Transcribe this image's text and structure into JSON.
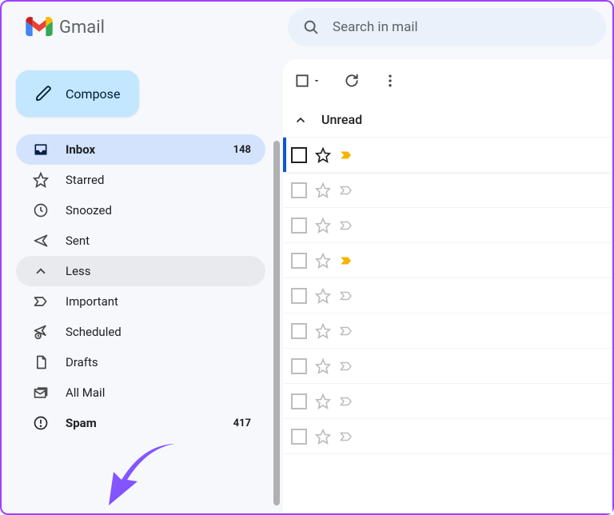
{
  "brand": {
    "name": "Gmail"
  },
  "search": {
    "placeholder": "Search in mail"
  },
  "compose": {
    "label": "Compose"
  },
  "sidebar": {
    "inbox": {
      "label": "Inbox",
      "count": "148"
    },
    "starred": {
      "label": "Starred"
    },
    "snoozed": {
      "label": "Snoozed"
    },
    "sent": {
      "label": "Sent"
    },
    "less": {
      "label": "Less"
    },
    "important": {
      "label": "Important"
    },
    "scheduled": {
      "label": "Scheduled"
    },
    "drafts": {
      "label": "Drafts"
    },
    "allmail": {
      "label": "All Mail"
    },
    "spam": {
      "label": "Spam",
      "count": "417"
    }
  },
  "mailbox": {
    "section": "Unread"
  }
}
